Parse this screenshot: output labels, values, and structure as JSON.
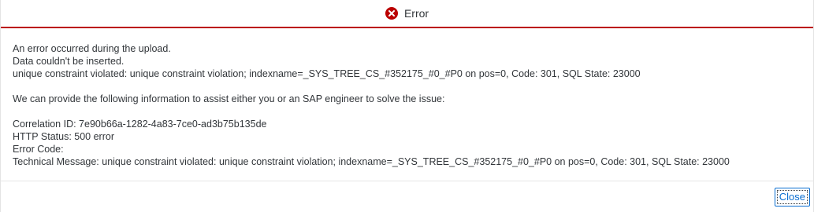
{
  "dialog": {
    "title": "Error",
    "icon": "error-circle-icon",
    "accent_color": "#bb0000"
  },
  "message": {
    "line1": "An error occurred during the upload.",
    "line2": "Data couldn't be inserted.",
    "line3": "unique constraint violated: unique constraint violation; indexname=_SYS_TREE_CS_#352175_#0_#P0 on pos=0, Code: 301, SQL State: 23000",
    "assist": "We can provide the following information to assist either you or an SAP engineer to solve the issue:",
    "correlation": "Correlation ID: 7e90b66a-1282-4a83-7ce0-ad3b75b135de",
    "http_status": "HTTP Status: 500 error",
    "error_code": "Error Code:",
    "technical": "Technical Message: unique constraint violated: unique constraint violation; indexname=_SYS_TREE_CS_#352175_#0_#P0 on pos=0, Code: 301, SQL State: 23000"
  },
  "footer": {
    "close_label": "Close"
  }
}
